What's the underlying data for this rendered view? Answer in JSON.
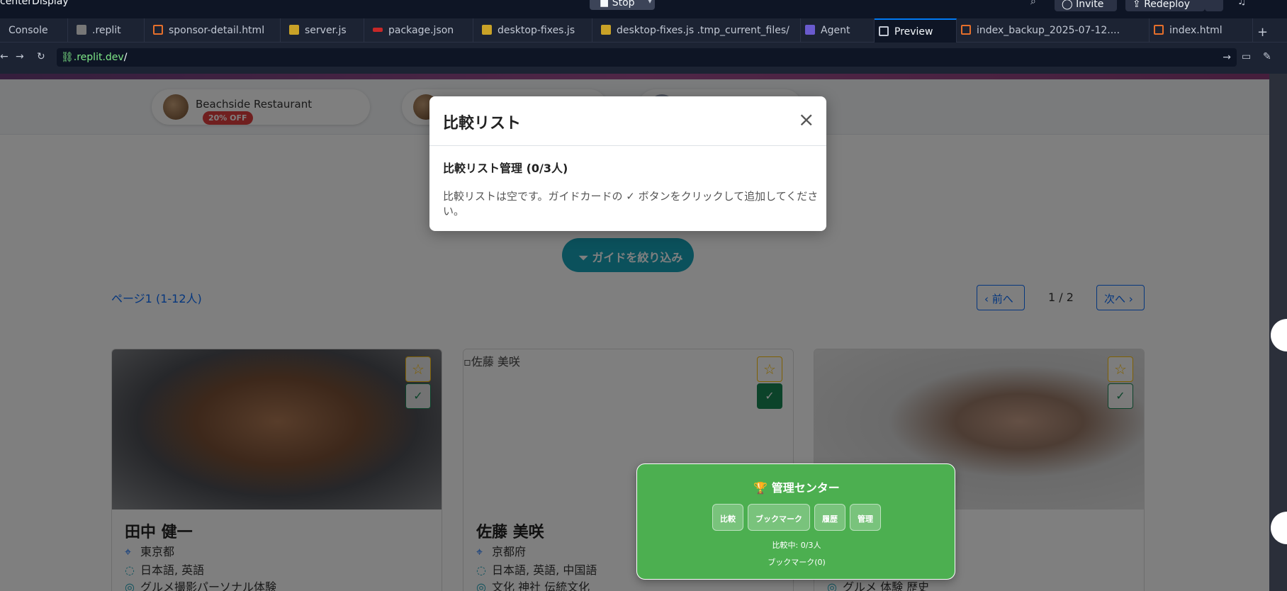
{
  "topbar": {
    "title": "centerDisplay",
    "stop": "Stop",
    "invite": "Invite",
    "redeploy": "Redeploy"
  },
  "tabs": [
    {
      "label": "Console"
    },
    {
      "label": ".replit"
    },
    {
      "label": "sponsor-detail.html"
    },
    {
      "label": "server.js"
    },
    {
      "label": "package.json"
    },
    {
      "label": "desktop-fixes.js"
    },
    {
      "label": "desktop-fixes.js .tmp_current_files/"
    },
    {
      "label": "Agent"
    },
    {
      "label": "Preview"
    },
    {
      "label": "index_backup_2025-07-12...."
    },
    {
      "label": "index.html"
    },
    {
      "label": "+"
    }
  ],
  "addressbar": {
    "url_host": ".replit.dev",
    "url_slash": "/"
  },
  "sponsors": [
    {
      "name": "Beachside Restaurant",
      "badge": "20% OFF"
    }
  ],
  "filter": {
    "label": "ガイドを絞り込み"
  },
  "pagination": {
    "label": "ページ1 (1-12人)",
    "prev": "前へ",
    "page": "1 / 2",
    "next": "次へ"
  },
  "guides": [
    {
      "name": "田中 健一",
      "location": "東京都",
      "languages": "日本語, 英語",
      "more": "グルメ撮影パーソナル体験"
    },
    {
      "name": "佐藤 美咲",
      "image_alt": "佐藤 美咲",
      "location": "京都府",
      "languages": "日本語, 英語, 中国語",
      "more": "文化 神社 伝統文化"
    },
    {
      "name": "",
      "location": "",
      "languages": "",
      "more": "グルメ 体験 歴史"
    }
  ],
  "modal": {
    "title": "比較リスト",
    "subtitle": "比較リスト管理 (0/3人)",
    "message": "比較リストは空です。ガイドカードの ✓ ボタンをクリックして追加してください。",
    "close": "×"
  },
  "management_center": {
    "title": "🏆 管理センター",
    "buttons": [
      "比較",
      "ブックマーク",
      "履歴",
      "管理"
    ],
    "comparing": "比較中: 0/3人",
    "bookmarks": "ブックマーク(0)"
  },
  "colors": {
    "accent": "#17a2b8",
    "primary": "#0d6efd",
    "management_green": "#4caf50",
    "badge_red": "#e03e3e"
  }
}
